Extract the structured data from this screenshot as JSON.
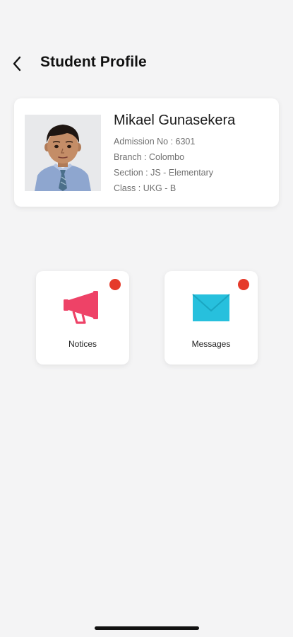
{
  "header": {
    "title": "Student Profile"
  },
  "student": {
    "name": "Mikael Gunasekera",
    "details": [
      {
        "label": "Admission No : ",
        "value": "6301"
      },
      {
        "label": "Branch : ",
        "value": "Colombo"
      },
      {
        "label": "Section : ",
        "value": "JS - Elementary"
      },
      {
        "label": "Class : ",
        "value": "UKG - B"
      }
    ]
  },
  "tiles": {
    "notices": {
      "label": "Notices",
      "icon": "megaphone-icon",
      "has_unread": true
    },
    "messages": {
      "label": "Messages",
      "icon": "envelope-icon",
      "has_unread": true
    }
  },
  "colors": {
    "background": "#f4f4f5",
    "megaphone": "#ee4267",
    "envelope": "#27c0dd",
    "badge": "#e53a2a"
  }
}
